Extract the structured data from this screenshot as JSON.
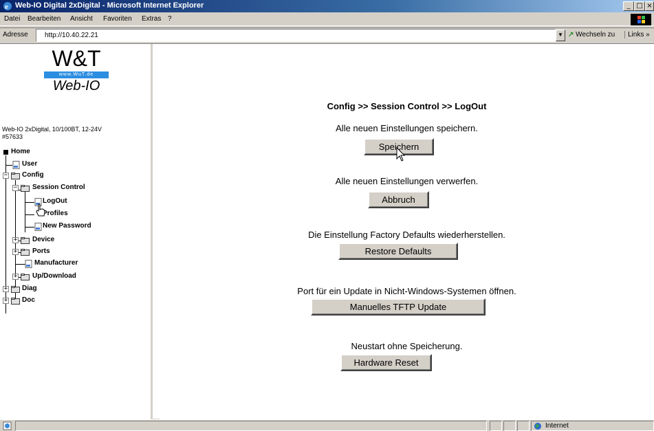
{
  "window": {
    "title": "Web-IO Digital 2xDigital - Microsoft Internet Explorer",
    "controls": {
      "minimize": "_",
      "maximize": "□",
      "close": "×"
    }
  },
  "menu": {
    "items": [
      {
        "label": "Datei"
      },
      {
        "label": "Bearbeiten"
      },
      {
        "label": "Ansicht"
      },
      {
        "label": "Favoriten"
      },
      {
        "label": "Extras"
      },
      {
        "label": "?"
      }
    ]
  },
  "address": {
    "label": "Adresse",
    "value": "http://10.40.22.21",
    "go_label": "Wechseln zu",
    "links_label": "Links »"
  },
  "sidebar": {
    "logo": {
      "brand": "W&T",
      "url": "www.WuT.de",
      "product": "Web-IO"
    },
    "device_info": [
      "Web-IO 2xDigital, 10/100BT, 12-24V",
      "#57633"
    ],
    "tree": {
      "home": "Home",
      "user": "User",
      "config": "Config",
      "session_control": "Session Control",
      "logout": "LogOut",
      "profiles": "Profiles",
      "new_password": "New Password",
      "device": "Device",
      "ports": "Ports",
      "manufacturer": "Manufacturer",
      "updownload": "Up/Download",
      "diag": "Diag",
      "doc": "Doc"
    }
  },
  "main": {
    "breadcrumb": "Config >> Session Control >> LogOut",
    "sections": {
      "save": {
        "text": "Alle neuen Einstellungen speichern.",
        "button": "Speichern"
      },
      "cancel": {
        "text": "Alle neuen Einstellungen verwerfen.",
        "button": "Abbruch"
      },
      "restore": {
        "text": "Die Einstellung Factory Defaults wiederherstellen.",
        "button": "Restore Defaults"
      },
      "tftp": {
        "text": "Port für ein Update in Nicht-Windows-Systemen öffnen.",
        "button": "Manuelles TFTP Update"
      },
      "reset": {
        "text": "Neustart ohne Speicherung.",
        "button": "Hardware Reset"
      }
    }
  },
  "status": {
    "zone": "Internet"
  },
  "colors": {
    "titlebar_start": "#0a246a",
    "titlebar_end": "#a6caf0",
    "chrome": "#d4d0c8",
    "logo_band": "#2b8ee0"
  }
}
